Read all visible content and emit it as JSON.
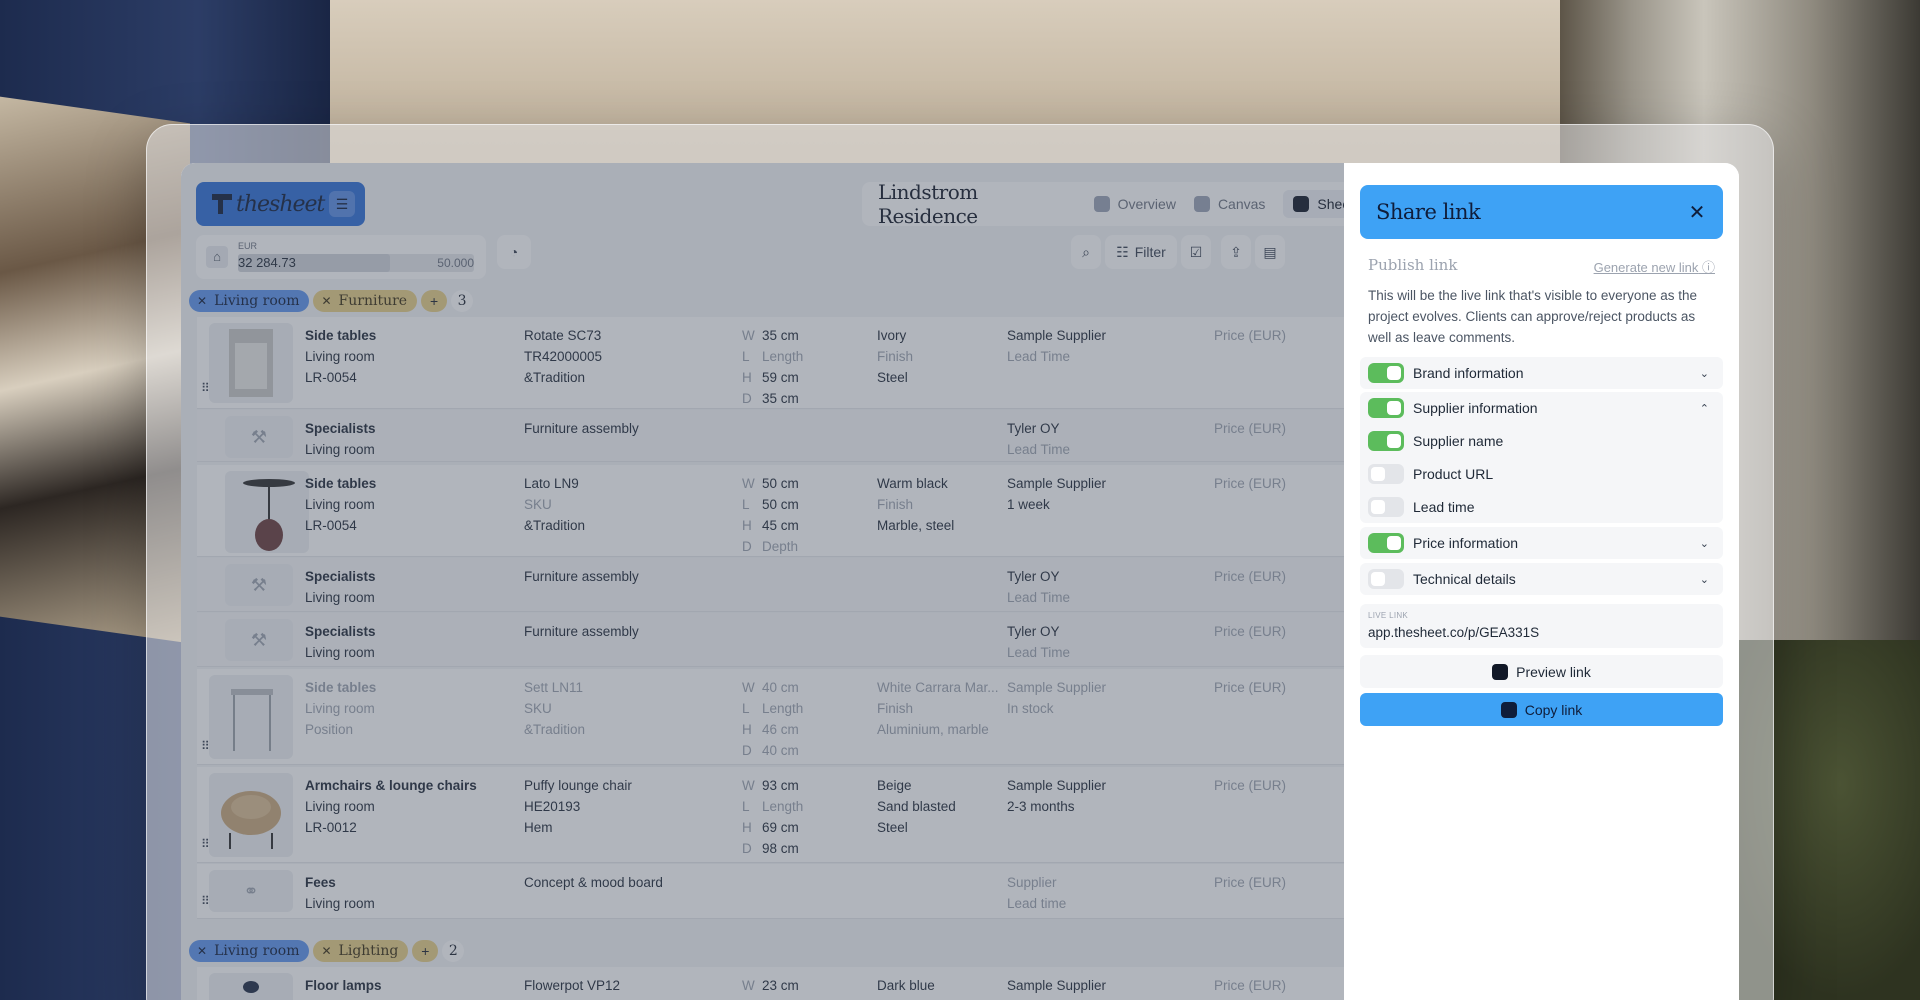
{
  "app": {
    "logo": "thesheet",
    "project_title": "Lindstrom Residence"
  },
  "nav": [
    {
      "label": "Overview",
      "icon": "overview-icon",
      "active": false
    },
    {
      "label": "Canvas",
      "icon": "canvas-icon",
      "active": false
    },
    {
      "label": "Sheet",
      "icon": "sheet-icon",
      "active": true
    }
  ],
  "budget": {
    "currency": "EUR",
    "spent": "32 284.73",
    "limit": "50.000",
    "fill_fraction": 0.6457
  },
  "toolbar": {
    "filter_label": "Filter"
  },
  "groups": [
    {
      "room": "Living room",
      "category": "Furniture",
      "count": "3"
    },
    {
      "room": "Living room",
      "category": "Lighting",
      "count": "2"
    }
  ],
  "rows": [
    {
      "name": "Side tables",
      "room": "Living room",
      "code": "LR-0054",
      "product": "Rotate SC73",
      "sku": "TR42000005",
      "brand": "&Tradition",
      "dims": [
        [
          "W",
          "35 cm"
        ],
        [
          "L",
          "Length"
        ],
        [
          "H",
          "59 cm"
        ],
        [
          "D",
          "35 cm"
        ]
      ],
      "finish": [
        "Ivory",
        "Finish",
        "Steel"
      ],
      "supplier": [
        "Sample Supplier",
        "Lead Time"
      ],
      "price": "Price (EUR)"
    },
    {
      "name": "Specialists",
      "room": "Living room",
      "product": "Furniture assembly",
      "supplier": [
        "Tyler OY",
        "Lead Time"
      ],
      "price": "Price (EUR)"
    },
    {
      "name": "Side tables",
      "room": "Living room",
      "code": "LR-0054",
      "product": "Lato LN9",
      "sku": "SKU",
      "brand": "&Tradition",
      "dims": [
        [
          "W",
          "50 cm"
        ],
        [
          "L",
          "50 cm"
        ],
        [
          "H",
          "45 cm"
        ],
        [
          "D",
          "Depth"
        ]
      ],
      "finish": [
        "Warm black",
        "Finish",
        "Marble, steel"
      ],
      "supplier": [
        "Sample Supplier",
        "1 week"
      ],
      "price": "Price (EUR)"
    },
    {
      "name": "Specialists",
      "room": "Living room",
      "product": "Furniture assembly",
      "supplier": [
        "Tyler OY",
        "Lead Time"
      ],
      "price": "Price (EUR)"
    },
    {
      "name": "Specialists",
      "room": "Living room",
      "product": "Furniture assembly",
      "supplier": [
        "Tyler OY",
        "Lead Time"
      ],
      "price": "Price (EUR)"
    },
    {
      "name": "Side tables",
      "room": "Living room",
      "code": "Position",
      "product": "Sett LN11",
      "sku": "SKU",
      "brand": "&Tradition",
      "dims": [
        [
          "W",
          "40 cm"
        ],
        [
          "L",
          "Length"
        ],
        [
          "H",
          "46 cm"
        ],
        [
          "D",
          "40 cm"
        ]
      ],
      "finish": [
        "White Carrara Mar...",
        "Finish",
        "Aluminium, marble"
      ],
      "supplier": [
        "Sample Supplier",
        "In stock"
      ],
      "price": "Price (EUR)"
    },
    {
      "name": "Armchairs & lounge chairs",
      "room": "Living room",
      "code": "LR-0012",
      "product": "Puffy lounge chair",
      "sku": "HE20193",
      "brand": "Hem",
      "dims": [
        [
          "W",
          "93 cm"
        ],
        [
          "L",
          "Length"
        ],
        [
          "H",
          "69 cm"
        ],
        [
          "D",
          "98 cm"
        ]
      ],
      "finish": [
        "Beige",
        "Sand blasted",
        "Steel"
      ],
      "supplier": [
        "Sample Supplier",
        "2-3 months"
      ],
      "price": "Price (EUR)"
    },
    {
      "name": "Fees",
      "room": "Living room",
      "product": "Concept & mood board",
      "supplier": [
        "Supplier",
        "Lead time"
      ],
      "price": "Price (EUR)"
    },
    {
      "name": "Floor lamps",
      "product": "Flowerpot VP12",
      "dims": [
        [
          "W",
          "23 cm"
        ]
      ],
      "finish": [
        "Dark blue"
      ],
      "supplier": [
        "Sample Supplier"
      ],
      "price": "Price (EUR)"
    }
  ],
  "share": {
    "title": "Share link",
    "publish_label": "Publish link",
    "generate_label": "Generate new link",
    "description": "This will be the live link that's visible to everyone as the project evolves. Clients can approve/reject products as well as leave comments.",
    "options": [
      {
        "label": "Brand information",
        "on": true
      },
      {
        "label": "Supplier information",
        "on": true
      },
      {
        "label": "Supplier name",
        "on": true
      },
      {
        "label": "Product URL",
        "on": false
      },
      {
        "label": "Lead time",
        "on": false
      },
      {
        "label": "Price information",
        "on": true
      },
      {
        "label": "Technical details",
        "on": false
      }
    ],
    "live_link_label": "LIVE LINK",
    "live_link": "app.thesheet.co/p/GEA331S",
    "preview_label": "Preview link",
    "copy_label": "Copy link"
  },
  "colors": {
    "accent": "#3ea2f5",
    "toggle_on": "#5cbc5c",
    "room_chip": "#5d94ee",
    "category_chip": "#e7cf86"
  }
}
